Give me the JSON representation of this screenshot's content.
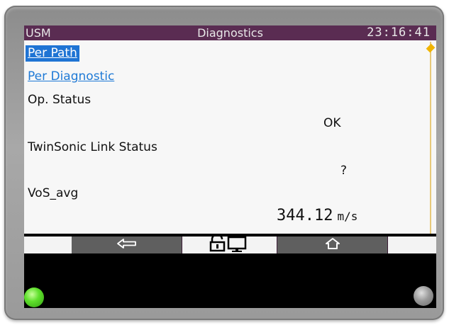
{
  "header": {
    "device_label": "USM",
    "title": "Diagnostics",
    "clock": "23:16:41"
  },
  "menu": {
    "per_path": "Per Path",
    "per_diagnostic": "Per Diagnostic"
  },
  "fields": {
    "op_status_label": "Op. Status",
    "op_status_value": "OK",
    "twinsonic_label": "TwinSonic Link Status",
    "twinsonic_value": "?",
    "vos_label": "VoS_avg",
    "vos_value": "344.12",
    "vos_unit": "m/s"
  },
  "navbar": {
    "back_icon": "back-arrow-icon",
    "lock_icon": "lock-screen-icon",
    "home_icon": "home-icon"
  },
  "colors": {
    "titlebar": "#5a2c52",
    "selection": "#1f74d4",
    "link": "#1f7ad6",
    "scroll_thumb": "#f0b400",
    "status_led": "#5fe02c"
  }
}
